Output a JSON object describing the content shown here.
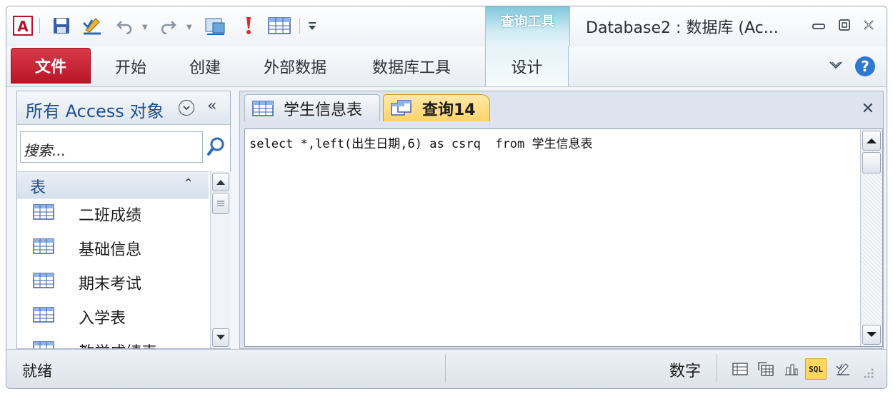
{
  "app": {
    "logo_letter": "A",
    "window_title": "Database2 : 数据库 (Ac..."
  },
  "ribbon": {
    "context_group": "查询工具",
    "tabs": [
      {
        "label": "文件",
        "kind": "file"
      },
      {
        "label": "开始"
      },
      {
        "label": "创建"
      },
      {
        "label": "外部数据"
      },
      {
        "label": "数据库工具"
      },
      {
        "label": "设计",
        "kind": "contextual"
      }
    ]
  },
  "nav": {
    "title": "所有 Access 对象",
    "search_placeholder": "搜索...",
    "group": "表",
    "items": [
      "二班成绩",
      "基础信息",
      "期末考试",
      "入学表",
      "教学成绩表"
    ]
  },
  "doc_tabs": [
    {
      "label": "学生信息表",
      "icon": "table-icon",
      "active": false
    },
    {
      "label": "查询14",
      "icon": "query-icon",
      "active": true
    }
  ],
  "editor": {
    "sql": "select *,left(出生日期,6) as csrq  from 学生信息表"
  },
  "status": {
    "left": "就绪",
    "mode": "数字",
    "sql_label": "SQL"
  },
  "colors": {
    "file_tab": "#c8202f",
    "context_tab": "#7fc7dc",
    "active_doc_tab": "#ffd36b",
    "help_icon": "#2f79d1"
  }
}
